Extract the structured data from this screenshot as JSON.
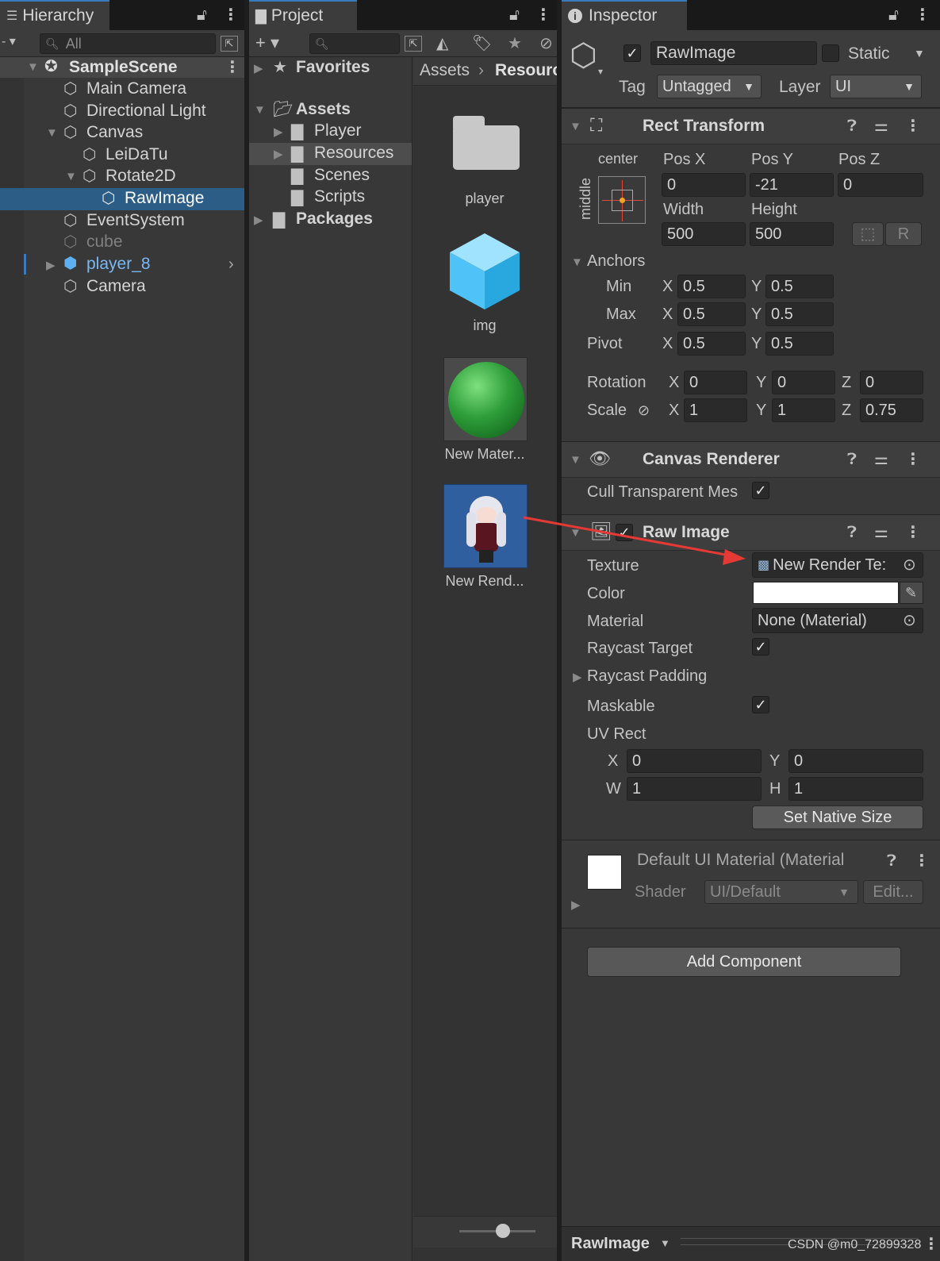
{
  "hierarchy": {
    "tab_label": "Hierarchy",
    "search_placeholder": "All",
    "scene": "SampleScene",
    "items": [
      {
        "label": "Main Camera"
      },
      {
        "label": "Directional Light"
      },
      {
        "label": "Canvas"
      },
      {
        "label": "LeiDaTu"
      },
      {
        "label": "Rotate2D"
      },
      {
        "label": "RawImage"
      },
      {
        "label": "EventSystem"
      },
      {
        "label": "cube"
      },
      {
        "label": "player_8"
      },
      {
        "label": "Camera"
      }
    ]
  },
  "project": {
    "tab_label": "Project",
    "tree": {
      "favorites": "Favorites",
      "assets": "Assets",
      "player": "Player",
      "resources": "Resources",
      "scenes": "Scenes",
      "scripts": "Scripts",
      "packages": "Packages"
    },
    "breadcrumb": {
      "root": "Assets",
      "current": "Resourc"
    },
    "assets": [
      {
        "label": "player"
      },
      {
        "label": "img"
      },
      {
        "label": "New Mater..."
      },
      {
        "label": "New Rend..."
      }
    ]
  },
  "inspector": {
    "tab_label": "Inspector",
    "object_name": "RawImage",
    "static_label": "Static",
    "tag_label": "Tag",
    "tag_value": "Untagged",
    "layer_label": "Layer",
    "layer_value": "UI",
    "rect_transform": {
      "title": "Rect Transform",
      "anchor_h": "center",
      "anchor_v": "middle",
      "posx_label": "Pos X",
      "posx": "0",
      "posy_label": "Pos Y",
      "posy": "-21",
      "posz_label": "Pos Z",
      "posz": "0",
      "width_label": "Width",
      "width": "500",
      "height_label": "Height",
      "height": "500",
      "anchors_label": "Anchors",
      "min_label": "Min",
      "min_x": "0.5",
      "min_y": "0.5",
      "max_label": "Max",
      "max_x": "0.5",
      "max_y": "0.5",
      "pivot_label": "Pivot",
      "pivot_x": "0.5",
      "pivot_y": "0.5",
      "rotation_label": "Rotation",
      "rot_x": "0",
      "rot_y": "0",
      "rot_z": "0",
      "scale_label": "Scale",
      "scale_x": "1",
      "scale_y": "1",
      "scale_z": "0.75",
      "r_button": "R"
    },
    "canvas_renderer": {
      "title": "Canvas Renderer",
      "cull_label": "Cull Transparent Mes"
    },
    "raw_image": {
      "title": "Raw Image",
      "texture_label": "Texture",
      "texture_value": "New Render Te:",
      "color_label": "Color",
      "color_value": "#ffffff",
      "material_label": "Material",
      "material_value": "None (Material)",
      "raycast_target_label": "Raycast Target",
      "raycast_padding_label": "Raycast Padding",
      "maskable_label": "Maskable",
      "uvrect_label": "UV Rect",
      "uv_x": "0",
      "uv_y": "0",
      "uv_w": "1",
      "uv_h": "1",
      "set_native_size": "Set Native Size"
    },
    "material_section": {
      "title": "Default UI Material (Material",
      "shader_label": "Shader",
      "shader_value": "UI/Default",
      "edit_button": "Edit..."
    },
    "add_component": "Add Component",
    "footer_label": "RawImage"
  },
  "axis_letters": {
    "x": "X",
    "y": "Y",
    "z": "Z",
    "w": "W",
    "h": "H"
  },
  "watermark": "CSDN @m0_72899328",
  "colors": {
    "accent": "#3a79bb",
    "selection": "#2c5d87",
    "prefab": "#7ab8f5",
    "arrow": "#e53935"
  }
}
